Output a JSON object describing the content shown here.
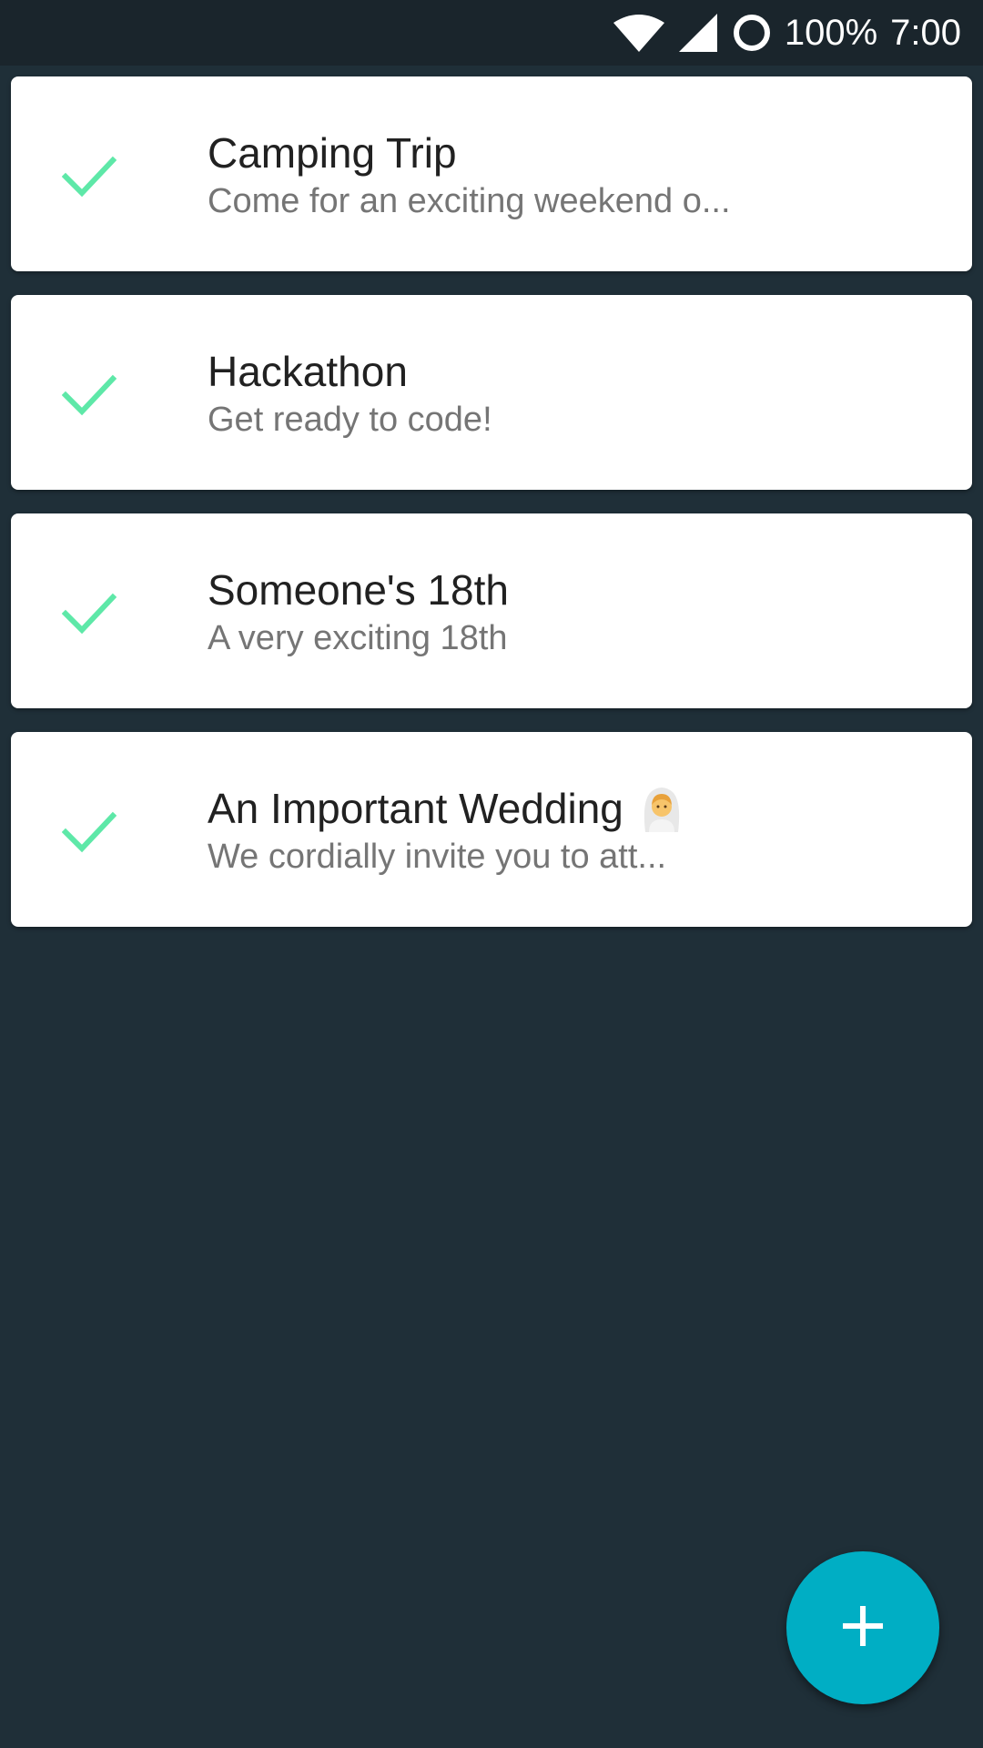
{
  "status_bar": {
    "battery_percent": "100%",
    "time": "7:00",
    "icons": [
      "wifi-icon",
      "cell-signal-icon",
      "sync-circle-icon"
    ]
  },
  "events": [
    {
      "title": "Camping Trip",
      "subtitle": "Come for an exciting weekend o...",
      "icon": "check-icon"
    },
    {
      "title": "Hackathon",
      "subtitle": "Get ready to code!",
      "icon": "check-icon"
    },
    {
      "title": "Someone's 18th",
      "subtitle": "A very exciting 18th",
      "icon": "check-icon"
    },
    {
      "title": "An Important Wedding",
      "subtitle": "We cordially invite you to att...",
      "icon": "check-icon",
      "title_emoji": "bride-with-veil-icon"
    }
  ],
  "fab": {
    "icon": "plus-icon"
  },
  "colors": {
    "background": "#1f2f38",
    "status_bar": "#1a252c",
    "card": "#ffffff",
    "check": "#5ee8a8",
    "fab": "#00aec4",
    "title_text": "#212121",
    "subtitle_text": "#757575"
  }
}
